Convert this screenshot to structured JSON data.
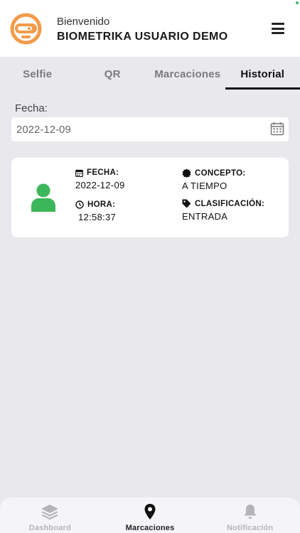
{
  "header": {
    "greeting": "Bienvenido",
    "username": "BIOMETRIKA USUARIO DEMO",
    "logo_icon": "robot-logo-icon",
    "menu_icon": "hamburger-menu-icon",
    "brand_color": "#f29b4a"
  },
  "tabs": [
    {
      "label": "Selfie",
      "active": false
    },
    {
      "label": "QR",
      "active": false
    },
    {
      "label": "Marcaciones",
      "active": false
    },
    {
      "label": "Historial",
      "active": true
    }
  ],
  "filter": {
    "label": "Fecha:",
    "value": "2022-12-09",
    "icon": "calendar-icon"
  },
  "record": {
    "avatar_icon": "user-icon",
    "avatar_color": "#3bb65a",
    "fecha_label": "FECHA:",
    "fecha_value": "2022-12-09",
    "hora_label": "HORA:",
    "hora_value": "12:58:37",
    "concepto_label": "CONCEPTO:",
    "concepto_value": "A TIEMPO",
    "clasificacion_label": "CLASIFICACIÓN:",
    "clasificacion_value": "ENTRADA"
  },
  "bottom_nav": [
    {
      "label": "Dashboard",
      "icon": "layers-icon",
      "active": false
    },
    {
      "label": "Marcaciones",
      "icon": "map-pin-icon",
      "active": true
    },
    {
      "label": "Notificación",
      "icon": "bell-icon",
      "active": false
    }
  ]
}
